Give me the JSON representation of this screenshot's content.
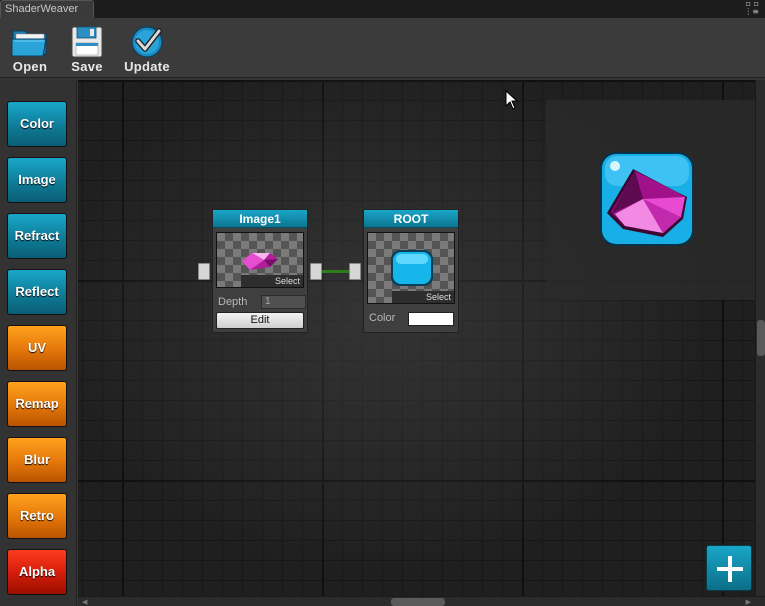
{
  "window": {
    "tab_title": "ShaderWeaver"
  },
  "toolbar": {
    "open_label": "Open",
    "save_label": "Save",
    "update_label": "Update"
  },
  "sidebar": {
    "items": [
      {
        "label": "Color",
        "color": "teal"
      },
      {
        "label": "Image",
        "color": "teal"
      },
      {
        "label": "Refract",
        "color": "teal"
      },
      {
        "label": "Reflect",
        "color": "teal"
      },
      {
        "label": "UV",
        "color": "orange"
      },
      {
        "label": "Remap",
        "color": "orange"
      },
      {
        "label": "Blur",
        "color": "orange"
      },
      {
        "label": "Retro",
        "color": "orange"
      },
      {
        "label": "Alpha",
        "color": "red"
      }
    ]
  },
  "nodes": {
    "image1": {
      "title": "Image1",
      "select_label": "Select",
      "depth_label": "Depth",
      "depth_value": "1",
      "edit_label": "Edit"
    },
    "root": {
      "title": "ROOT",
      "select_label": "Select",
      "color_label": "Color",
      "color_value": "#ffffff"
    }
  },
  "colors": {
    "accent_teal": "#1aa6c8",
    "accent_orange": "#e4770a",
    "accent_red": "#d11c0a",
    "link_green": "#2e7d1b"
  },
  "icons": {
    "open": "folder-icon",
    "save": "floppy-disk-icon",
    "update": "checkmark-icon",
    "add": "plus-icon"
  }
}
